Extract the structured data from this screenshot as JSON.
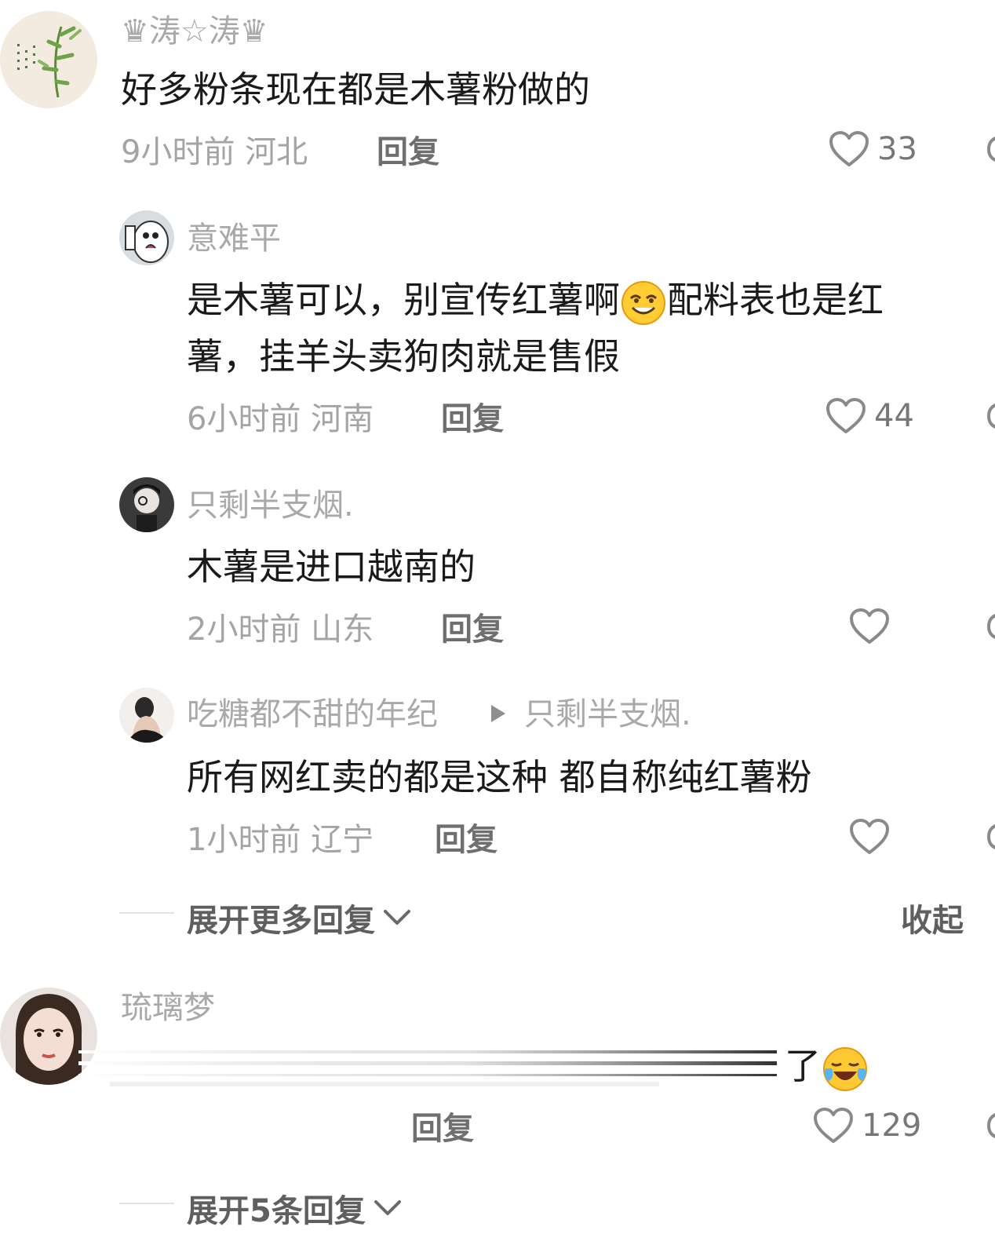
{
  "comments": [
    {
      "user": "♛涛☆涛♛",
      "text": "好多粉条现在都是木薯粉做的",
      "meta": "9小时前 河北",
      "reply": "回复",
      "likes": "33"
    }
  ],
  "replies": [
    {
      "user": "意难平",
      "text_line1": "是木薯可以，别宣传红薯啊",
      "text_line1b": "配料表也是红",
      "text_line2": "薯，挂羊头卖狗肉就是售假",
      "meta": "6小时前 河南",
      "reply": "回复",
      "likes": "44"
    },
    {
      "user": "只剩半支烟.",
      "text": "木薯是进口越南的",
      "meta": "2小时前 山东",
      "reply": "回复"
    },
    {
      "user": "吃糖都不甜的年纪",
      "reply_to": "只剩半支烟.",
      "text": "所有网红卖的都是这种 都自称纯红薯粉",
      "meta": "1小时前 辽宁",
      "reply": "回复"
    }
  ],
  "expand_more": "展开更多回复",
  "collapse": "收起",
  "second_comment": {
    "user": "琉璃梦",
    "text_visible": "了",
    "reply": "回复",
    "likes": "129",
    "expand": "展开5条回复"
  },
  "colors": {
    "username": "#a9a9a9",
    "body": "#1a1a1a",
    "meta": "#a4a4a4",
    "reply": "#6f6f6f"
  },
  "icons": [
    "heart-icon",
    "chevron-down-icon",
    "play-arrow-icon",
    "grin-emoji-icon",
    "laugh-cry-emoji-icon"
  ]
}
